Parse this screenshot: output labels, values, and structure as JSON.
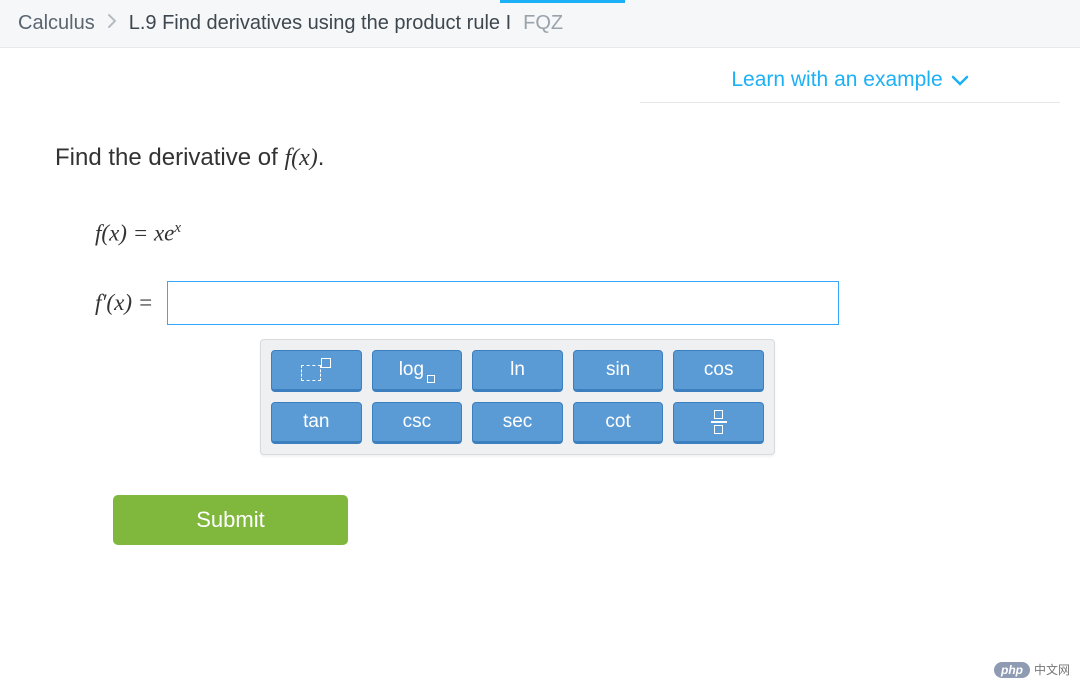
{
  "breadcrumb": {
    "subject": "Calculus",
    "skill": "L.9 Find derivatives using the product rule I",
    "code": "FQZ"
  },
  "learn_label": "Learn with an example",
  "prompt_prefix": "Find the derivative of ",
  "prompt_fx": "f(x)",
  "prompt_suffix": ".",
  "equation": {
    "f": "f",
    "open": "(",
    "x": "x",
    "close": ") = ",
    "xe": "xe",
    "sup": "x"
  },
  "fprime": {
    "f": "f′",
    "open": "(",
    "x": "x",
    "close": ") ="
  },
  "answer_value": "",
  "keys": {
    "exp": "",
    "log": "log",
    "ln": "ln",
    "sin": "sin",
    "cos": "cos",
    "tan": "tan",
    "csc": "csc",
    "sec": "sec",
    "cot": "cot",
    "frac": ""
  },
  "submit_label": "Submit",
  "footer": {
    "pill": "php",
    "text": "中文网"
  }
}
